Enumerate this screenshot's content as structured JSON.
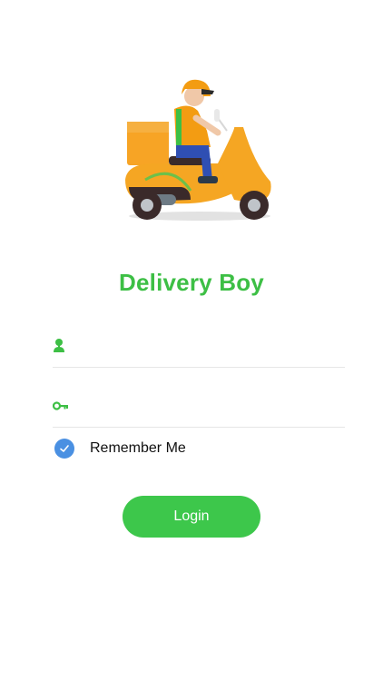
{
  "app": {
    "title": "Delivery Boy"
  },
  "hero": {
    "image": "delivery-scooter-illustration",
    "colors": {
      "scooter": "#f5a623",
      "rider_shirt": "#f39c12",
      "rider_pants": "#2f4fb3",
      "accent": "#3dbf45"
    }
  },
  "form": {
    "username": {
      "value": "",
      "placeholder": "",
      "icon": "user-icon"
    },
    "password": {
      "value": "",
      "placeholder": "",
      "icon": "key-icon"
    },
    "remember": {
      "label": "Remember Me",
      "checked": true
    },
    "login_label": "Login"
  },
  "colors": {
    "primary_green": "#3dbf45",
    "button_green": "#3dc74b",
    "checkbox_blue": "#4a90e2",
    "divider": "#e6e6e6"
  }
}
